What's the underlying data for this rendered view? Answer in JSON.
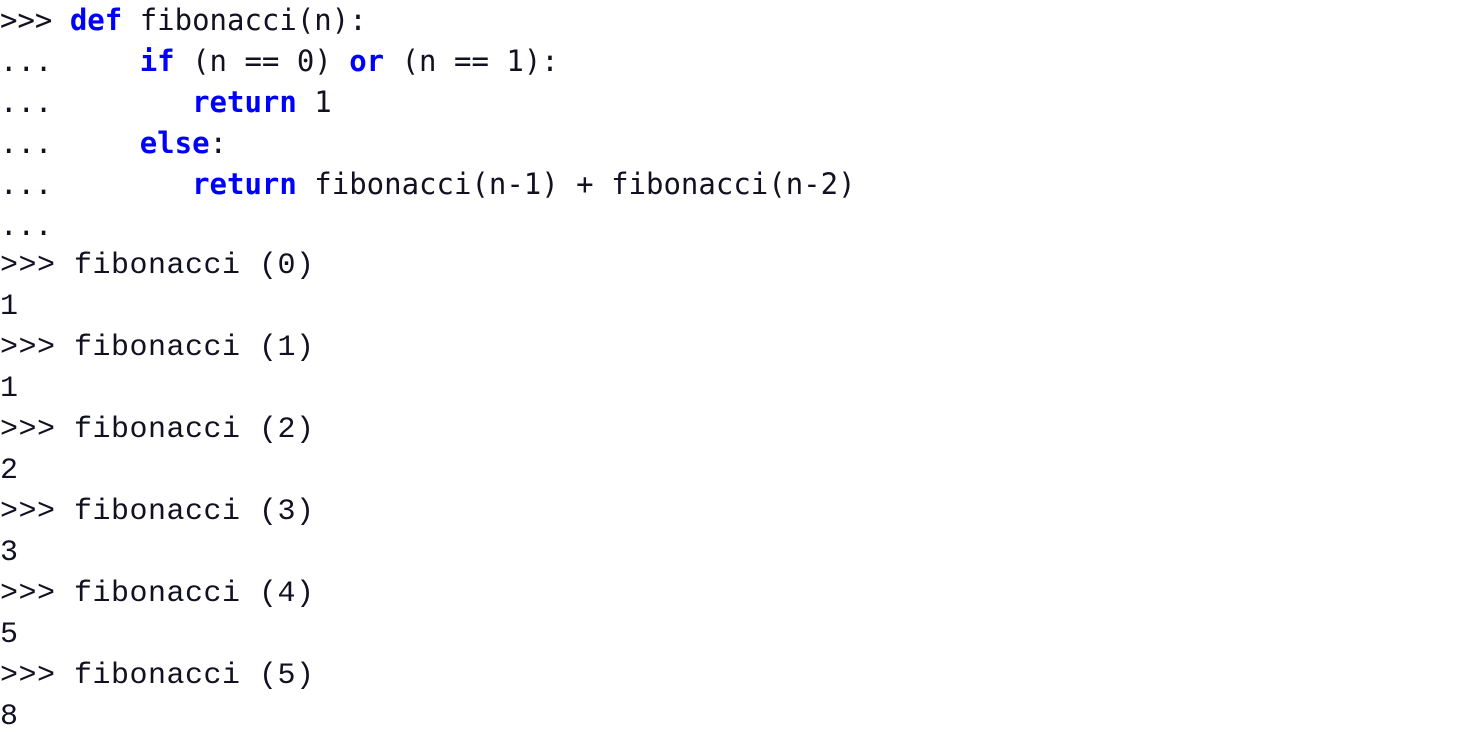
{
  "terminal": {
    "background_color": "#ffffff",
    "text_color": "#111122",
    "keyword_color": "#0000ff",
    "prompt_primary": ">>>",
    "prompt_continuation": "...",
    "lines": [
      {
        "id": "line-1",
        "kind": "code",
        "prompt": ">>> ",
        "indent": "",
        "segments": [
          {
            "type": "keyword",
            "text": "def"
          },
          {
            "type": "plain",
            "text": " fibonacci(n):"
          }
        ],
        "plain_text": ">>> def fibonacci(n):"
      },
      {
        "id": "line-2",
        "kind": "code",
        "prompt": "... ",
        "indent": "    ",
        "segments": [
          {
            "type": "keyword",
            "text": "if"
          },
          {
            "type": "plain",
            "text": " (n == 0) "
          },
          {
            "type": "keyword",
            "text": "or"
          },
          {
            "type": "plain",
            "text": " (n == 1):"
          }
        ],
        "plain_text": "...     if (n == 0) or (n == 1):"
      },
      {
        "id": "line-3",
        "kind": "code",
        "prompt": "... ",
        "indent": "       ",
        "segments": [
          {
            "type": "keyword",
            "text": "return"
          },
          {
            "type": "plain",
            "text": " 1"
          }
        ],
        "plain_text": "...        return 1"
      },
      {
        "id": "line-4",
        "kind": "code",
        "prompt": "... ",
        "indent": "    ",
        "segments": [
          {
            "type": "keyword",
            "text": "else"
          },
          {
            "type": "plain",
            "text": ":"
          }
        ],
        "plain_text": "...     else:"
      },
      {
        "id": "line-5",
        "kind": "code",
        "prompt": "... ",
        "indent": "       ",
        "segments": [
          {
            "type": "keyword",
            "text": "return"
          },
          {
            "type": "plain",
            "text": " fibonacci(n-1) + fibonacci(n-2)"
          }
        ],
        "plain_text": "...        return fibonacci(n-1) + fibonacci(n-2)"
      },
      {
        "id": "line-6",
        "kind": "code",
        "prompt": "...",
        "indent": "",
        "segments": [],
        "plain_text": "..."
      },
      {
        "id": "line-7",
        "kind": "io",
        "prompt": ">>> ",
        "indent": "",
        "segments": [
          {
            "type": "plain",
            "text": "fibonacci (0)"
          }
        ],
        "plain_text": ">>> fibonacci (0)"
      },
      {
        "id": "line-8",
        "kind": "output",
        "prompt": "",
        "indent": "",
        "segments": [
          {
            "type": "plain",
            "text": "1"
          }
        ],
        "plain_text": "1"
      },
      {
        "id": "line-9",
        "kind": "io",
        "prompt": ">>> ",
        "indent": "",
        "segments": [
          {
            "type": "plain",
            "text": "fibonacci (1)"
          }
        ],
        "plain_text": ">>> fibonacci (1)"
      },
      {
        "id": "line-10",
        "kind": "output",
        "prompt": "",
        "indent": "",
        "segments": [
          {
            "type": "plain",
            "text": "1"
          }
        ],
        "plain_text": "1"
      },
      {
        "id": "line-11",
        "kind": "io",
        "prompt": ">>> ",
        "indent": "",
        "segments": [
          {
            "type": "plain",
            "text": "fibonacci (2)"
          }
        ],
        "plain_text": ">>> fibonacci (2)"
      },
      {
        "id": "line-12",
        "kind": "output",
        "prompt": "",
        "indent": "",
        "segments": [
          {
            "type": "plain",
            "text": "2"
          }
        ],
        "plain_text": "2"
      },
      {
        "id": "line-13",
        "kind": "io",
        "prompt": ">>> ",
        "indent": "",
        "segments": [
          {
            "type": "plain",
            "text": "fibonacci (3)"
          }
        ],
        "plain_text": ">>> fibonacci (3)"
      },
      {
        "id": "line-14",
        "kind": "output",
        "prompt": "",
        "indent": "",
        "segments": [
          {
            "type": "plain",
            "text": "3"
          }
        ],
        "plain_text": "3"
      },
      {
        "id": "line-15",
        "kind": "io",
        "prompt": ">>> ",
        "indent": "",
        "segments": [
          {
            "type": "plain",
            "text": "fibonacci (4)"
          }
        ],
        "plain_text": ">>> fibonacci (4)"
      },
      {
        "id": "line-16",
        "kind": "output",
        "prompt": "",
        "indent": "",
        "segments": [
          {
            "type": "plain",
            "text": "5"
          }
        ],
        "plain_text": "5"
      },
      {
        "id": "line-17",
        "kind": "io",
        "prompt": ">>> ",
        "indent": "",
        "segments": [
          {
            "type": "plain",
            "text": "fibonacci (5)"
          }
        ],
        "plain_text": ">>> fibonacci (5)"
      },
      {
        "id": "line-18",
        "kind": "output",
        "prompt": "",
        "indent": "",
        "segments": [
          {
            "type": "plain",
            "text": "8"
          }
        ],
        "plain_text": "8"
      }
    ]
  }
}
